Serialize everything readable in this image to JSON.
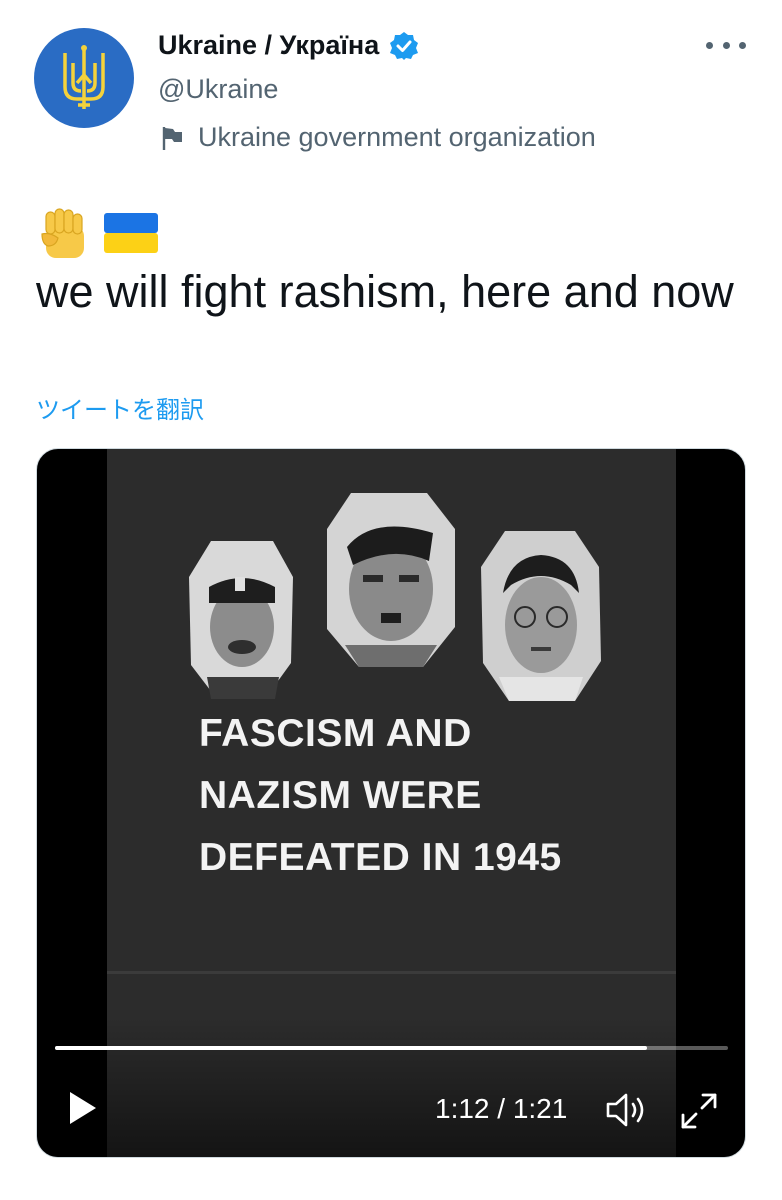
{
  "account": {
    "display_name": "Ukraine / Україна",
    "handle": "@Ukraine",
    "affiliation": "Ukraine government organization",
    "avatar_icon": "ukraine-trident-icon",
    "avatar_color": "#2a6cc4",
    "verified_icon": "verified-badge-icon",
    "verified_color": "#1d9bf0",
    "affiliation_icon": "flag-icon"
  },
  "tweet": {
    "emojis": [
      "raised-fist-icon",
      "ukraine-flag-icon"
    ],
    "text": "we will fight rashism, here and now",
    "translate_label": "ツイートを翻訳"
  },
  "video": {
    "caption_lines": [
      "FASCISM AND",
      "NAZISM WERE",
      "DEFEATED IN 1945"
    ],
    "time_display": "1:12 / 1:21",
    "progress": 0.88,
    "controls": {
      "play_icon": "play-icon",
      "volume_icon": "volume-icon",
      "fullscreen_icon": "fullscreen-icon"
    }
  },
  "menu": {
    "more_icon": "more-options-icon"
  },
  "colors": {
    "text_primary": "#0f1419",
    "text_secondary": "#536471",
    "link": "#1d9bf0",
    "video_bg": "#2c2c2c"
  }
}
